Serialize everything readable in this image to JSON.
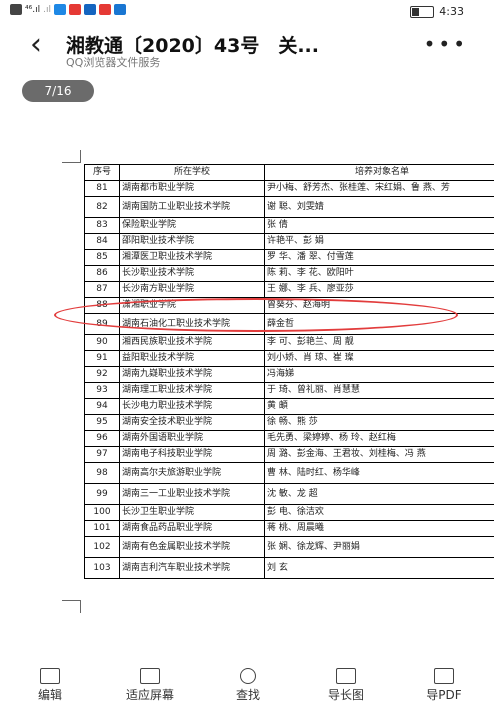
{
  "status": {
    "time": "4:33",
    "icons": [
      "data-icon",
      "signal-icon",
      "wifi-icon",
      "app-icon",
      "mail-icon",
      "app-icon",
      "bell-icon",
      "app-icon"
    ],
    "battery_level": 0.35
  },
  "header": {
    "title": "湘教通〔2020〕43号　关...",
    "subtitle": "QQ浏览器文件服务",
    "back_icon": "chevron-left-icon",
    "more_icon": "more-icon"
  },
  "page_indicator": "7/16",
  "table": {
    "headers": [
      "序号",
      "所在学校",
      "培养对象名单"
    ],
    "rows": [
      {
        "no": "81",
        "school": "湖南都市职业学院",
        "names": "尹小梅、舒芳杰、张桂莲、宋红娟、鲁 燕、芳"
      },
      {
        "no": "82",
        "school": "湖南国防工业职业技术学院",
        "names": "谢 聪、刘雯婧"
      },
      {
        "no": "83",
        "school": "保险职业学院",
        "names": "张 倩"
      },
      {
        "no": "84",
        "school": "邵阳职业技术学院",
        "names": "许艳平、彭 娟"
      },
      {
        "no": "85",
        "school": "湘潭医卫职业技术学院",
        "names": "罗 华、潘 翠、付雪莲"
      },
      {
        "no": "86",
        "school": "长沙职业技术学院",
        "names": "陈 莉、李 花、欧阳叶"
      },
      {
        "no": "87",
        "school": "长沙南方职业学院",
        "names": "王 娜、李 兵、廖亚莎"
      },
      {
        "no": "88",
        "school": "潇湘职业学院",
        "names": "曾葵芬、赵海明"
      },
      {
        "no": "89",
        "school": "湖南石油化工职业技术学院",
        "names": "薛金哲"
      },
      {
        "no": "90",
        "school": "湘西民族职业技术学院",
        "names": "李 可、彭艳兰、周 靓"
      },
      {
        "no": "91",
        "school": "益阳职业技术学院",
        "names": "刘小娇、肖 琼、崔 璨"
      },
      {
        "no": "92",
        "school": "湖南九嶷职业技术学院",
        "names": "冯海娣"
      },
      {
        "no": "93",
        "school": "湖南理工职业技术学院",
        "names": "于 琦、曾礼丽、肖慧慧"
      },
      {
        "no": "94",
        "school": "长沙电力职业技术学院",
        "names": "黄 頔"
      },
      {
        "no": "95",
        "school": "湖南安全技术职业学院",
        "names": "徐 畅、熊 莎"
      },
      {
        "no": "96",
        "school": "湖南外国语职业学院",
        "names": "毛先勇、梁婷婷、杨 玲、赵红梅"
      },
      {
        "no": "97",
        "school": "湖南电子科技职业学院",
        "names": "周 潞、彭金海、王君妆、刘桂梅、冯 燕"
      },
      {
        "no": "98",
        "school": "湖南高尔夫旅游职业学院",
        "names": "曹 林、陆时红、杨华峰"
      },
      {
        "no": "99",
        "school": "湖南三一工业职业技术学院",
        "names": "沈 敏、龙 超"
      },
      {
        "no": "100",
        "school": "长沙卫生职业学院",
        "names": "彭 电、徐洁欢"
      },
      {
        "no": "101",
        "school": "湖南食品药品职业学院",
        "names": "蒋 桃、周晨曦"
      },
      {
        "no": "102",
        "school": "湖南有色金属职业技术学院",
        "names": "张 娴、徐龙辉、尹丽娟"
      },
      {
        "no": "103",
        "school": "湖南吉利汽车职业技术学院",
        "names": "刘 玄"
      }
    ]
  },
  "bottom_bar": [
    {
      "label": "编辑",
      "icon": "edit-icon"
    },
    {
      "label": "适应屏幕",
      "icon": "fit-screen-icon"
    },
    {
      "label": "查找",
      "icon": "search-icon"
    },
    {
      "label": "导长图",
      "icon": "long-image-icon"
    },
    {
      "label": "导PDF",
      "icon": "pdf-export-icon"
    }
  ]
}
